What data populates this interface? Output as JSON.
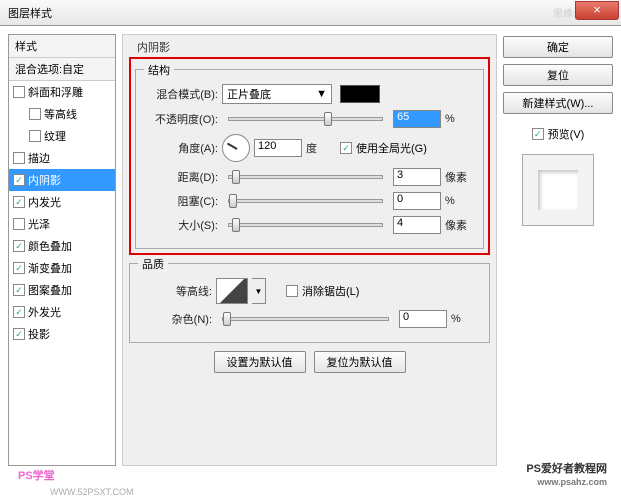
{
  "title": "图层样式",
  "title_right": "思缘设计论坛",
  "left": {
    "header": "样式",
    "subheader": "混合选项:自定",
    "items": [
      {
        "label": "斜面和浮雕",
        "checked": false,
        "indent": false
      },
      {
        "label": "等高线",
        "checked": false,
        "indent": true
      },
      {
        "label": "纹理",
        "checked": false,
        "indent": true
      },
      {
        "label": "描边",
        "checked": false,
        "indent": false
      },
      {
        "label": "内阴影",
        "checked": true,
        "indent": false,
        "selected": true
      },
      {
        "label": "内发光",
        "checked": true,
        "indent": false
      },
      {
        "label": "光泽",
        "checked": false,
        "indent": false
      },
      {
        "label": "颜色叠加",
        "checked": true,
        "indent": false
      },
      {
        "label": "渐变叠加",
        "checked": true,
        "indent": false
      },
      {
        "label": "图案叠加",
        "checked": true,
        "indent": false
      },
      {
        "label": "外发光",
        "checked": true,
        "indent": false
      },
      {
        "label": "投影",
        "checked": true,
        "indent": false
      }
    ]
  },
  "center": {
    "section": "内阴影",
    "structure": {
      "title": "结构",
      "blend_label": "混合模式(B):",
      "blend_value": "正片叠底",
      "opacity_label": "不透明度(O):",
      "opacity_value": "65",
      "opacity_unit": "%",
      "angle_label": "角度(A):",
      "angle_value": "120",
      "angle_unit": "度",
      "global_light": "使用全局光(G)",
      "distance_label": "距离(D):",
      "distance_value": "3",
      "distance_unit": "像素",
      "choke_label": "阻塞(C):",
      "choke_value": "0",
      "choke_unit": "%",
      "size_label": "大小(S):",
      "size_value": "4",
      "size_unit": "像素"
    },
    "quality": {
      "title": "品质",
      "contour_label": "等高线:",
      "antialias": "消除锯齿(L)",
      "noise_label": "杂色(N):",
      "noise_value": "0",
      "noise_unit": "%"
    },
    "btn_default": "设置为默认值",
    "btn_reset": "复位为默认值"
  },
  "right": {
    "ok": "确定",
    "cancel": "复位",
    "new_style": "新建样式(W)...",
    "preview_label": "预览(V)"
  },
  "wm_left": "PS学堂",
  "wm_left_url": "WWW.52PSXT.COM",
  "wm_right": "PS爱好者教程网",
  "wm_right_url": "www.psahz.com"
}
